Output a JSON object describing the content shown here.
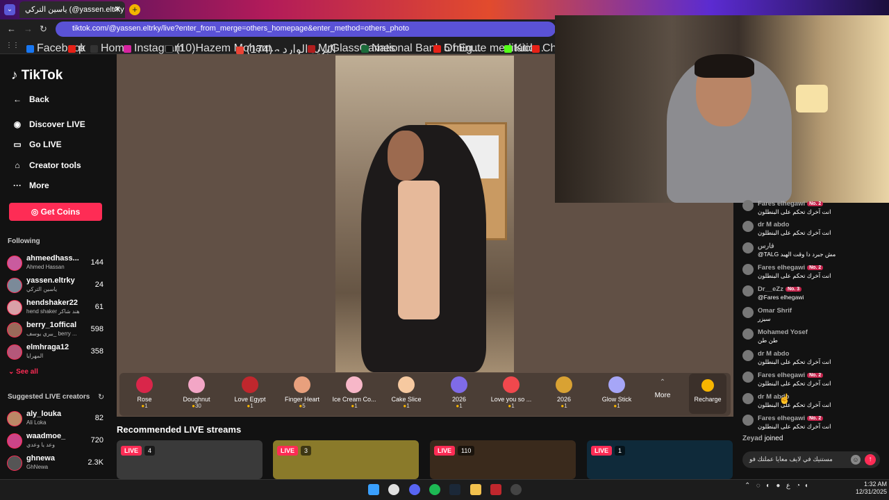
{
  "browser": {
    "tab_title": "ياسين التركي (@yassen.eltrky",
    "tab_close": "✕",
    "new_tab": "+",
    "url": "tiktok.com/@yassen.eltrky/live?enter_from_merge=others_homepage&enter_method=others_photo",
    "bookmarks": [
      "Facebook",
      "p",
      "Home",
      "Instagram",
      "(10)Hazem Moham...",
      "البريد الوارد - (174)",
      "MrGlassGames",
      "National Bank Of Eg...",
      "5 minute meditatio...",
      "Kick",
      "Char"
    ]
  },
  "sidebar": {
    "logo": "TikTok",
    "nav": [
      {
        "label": "Back",
        "icon": "←"
      },
      {
        "label": "Discover LIVE",
        "icon": "◉"
      },
      {
        "label": "Go LIVE",
        "icon": "▭"
      },
      {
        "label": "Creator tools",
        "icon": "⌂"
      },
      {
        "label": "More",
        "icon": "···"
      }
    ],
    "get_coins": "Get Coins",
    "following_title": "Following",
    "following": [
      {
        "name": "ahmeedhass...",
        "sub": "Ahmed Hassan",
        "count": "144"
      },
      {
        "name": "yassen.eltrky",
        "sub": "ياسين التركي",
        "count": "24"
      },
      {
        "name": "hendshaker22",
        "sub": "hend shaker هند شاكر",
        "count": "61"
      },
      {
        "name": "berry_1offical",
        "sub": "بيري يوسف_ berry ...",
        "count": "598"
      },
      {
        "name": "elmhraga12",
        "sub": "المهرايا",
        "count": "358"
      }
    ],
    "see_all": "See all",
    "suggested_title": "Suggested LIVE creators",
    "suggested": [
      {
        "name": "aly_louka",
        "sub": "Ali Loka",
        "count": "82"
      },
      {
        "name": "waadmoe_",
        "sub": "وعد يا وعدي",
        "count": "720"
      },
      {
        "name": "ghnewa",
        "sub": "GhNewa",
        "count": "2.3K"
      }
    ]
  },
  "gifts": [
    {
      "name": "Rose",
      "price": "1",
      "color": "#d9264a"
    },
    {
      "name": "Doughnut",
      "price": "30",
      "color": "#f3a6c6"
    },
    {
      "name": "Love Egypt",
      "price": "1",
      "color": "#c0272d"
    },
    {
      "name": "Finger Heart",
      "price": "5",
      "color": "#e8a07d"
    },
    {
      "name": "Ice Cream Co...",
      "price": "1",
      "color": "#f7b7c8"
    },
    {
      "name": "Cake Slice",
      "price": "1",
      "color": "#f6c9a0"
    },
    {
      "name": "2026",
      "price": "1",
      "color": "#7f6be8"
    },
    {
      "name": "Love you so ...",
      "price": "1",
      "color": "#f1484d"
    },
    {
      "name": "2026",
      "price": "1",
      "color": "#d9a233"
    },
    {
      "name": "Glow Stick",
      "price": "1",
      "color": "#a6a6f7"
    }
  ],
  "gift_more": "More",
  "recharge": "Recharge",
  "recommended": {
    "title": "Recommended LIVE streams",
    "streams": [
      {
        "live": "LIVE",
        "viewers": "4",
        "bg": "#3a3a3a"
      },
      {
        "live": "LIVE",
        "viewers": "3",
        "bg": "#8a7a2a"
      },
      {
        "live": "LIVE",
        "viewers": "110",
        "bg": "#3a2a1c"
      },
      {
        "live": "LIVE",
        "viewers": "1",
        "bg": "#0f2a3a"
      }
    ]
  },
  "chat": {
    "messages": [
      {
        "user": "Fares elhegawi",
        "badge": "No. 2",
        "text": "انت آخرك تحكم على البنطلون"
      },
      {
        "user": "dr M abdo",
        "badge": "",
        "text": "انت آخرك تحكم على البنطلون"
      },
      {
        "user": "فارس",
        "badge": "",
        "text": "@TALG مش جبرد دا وقت الهبد"
      },
      {
        "user": "Fares elhegawi",
        "badge": "No. 2",
        "text": "انت آخرك تحكم على البنطلون"
      },
      {
        "user": "Dr__eZz",
        "badge": "No. 3",
        "text": "@Fares elhegawi"
      },
      {
        "user": "Omar Shrif",
        "badge": "",
        "text": "سيزر"
      },
      {
        "user": "Mohamed Yosef",
        "badge": "",
        "text": "طن طن"
      },
      {
        "user": "dr M abdo",
        "badge": "",
        "text": "انت آخرك تحكم على البنطلون"
      },
      {
        "user": "Fares elhegawi",
        "badge": "No. 2",
        "text": "انت آخرك تحكم على البنطلون"
      },
      {
        "user": "dr M abdo",
        "badge": "",
        "text": "انت آخرك تحكم على البنطلون"
      },
      {
        "user": "Fares elhegawi",
        "badge": "No. 2",
        "text": "انت آخرك تحكم على البنطلون"
      }
    ],
    "joined_user": "Zeyad",
    "joined_text": "joined",
    "input_value": "مستنيك في لايف معايا عملتك فو"
  },
  "taskbar": {
    "lang": "ع",
    "time": "1:32 AM",
    "date": "12/31/2025"
  }
}
